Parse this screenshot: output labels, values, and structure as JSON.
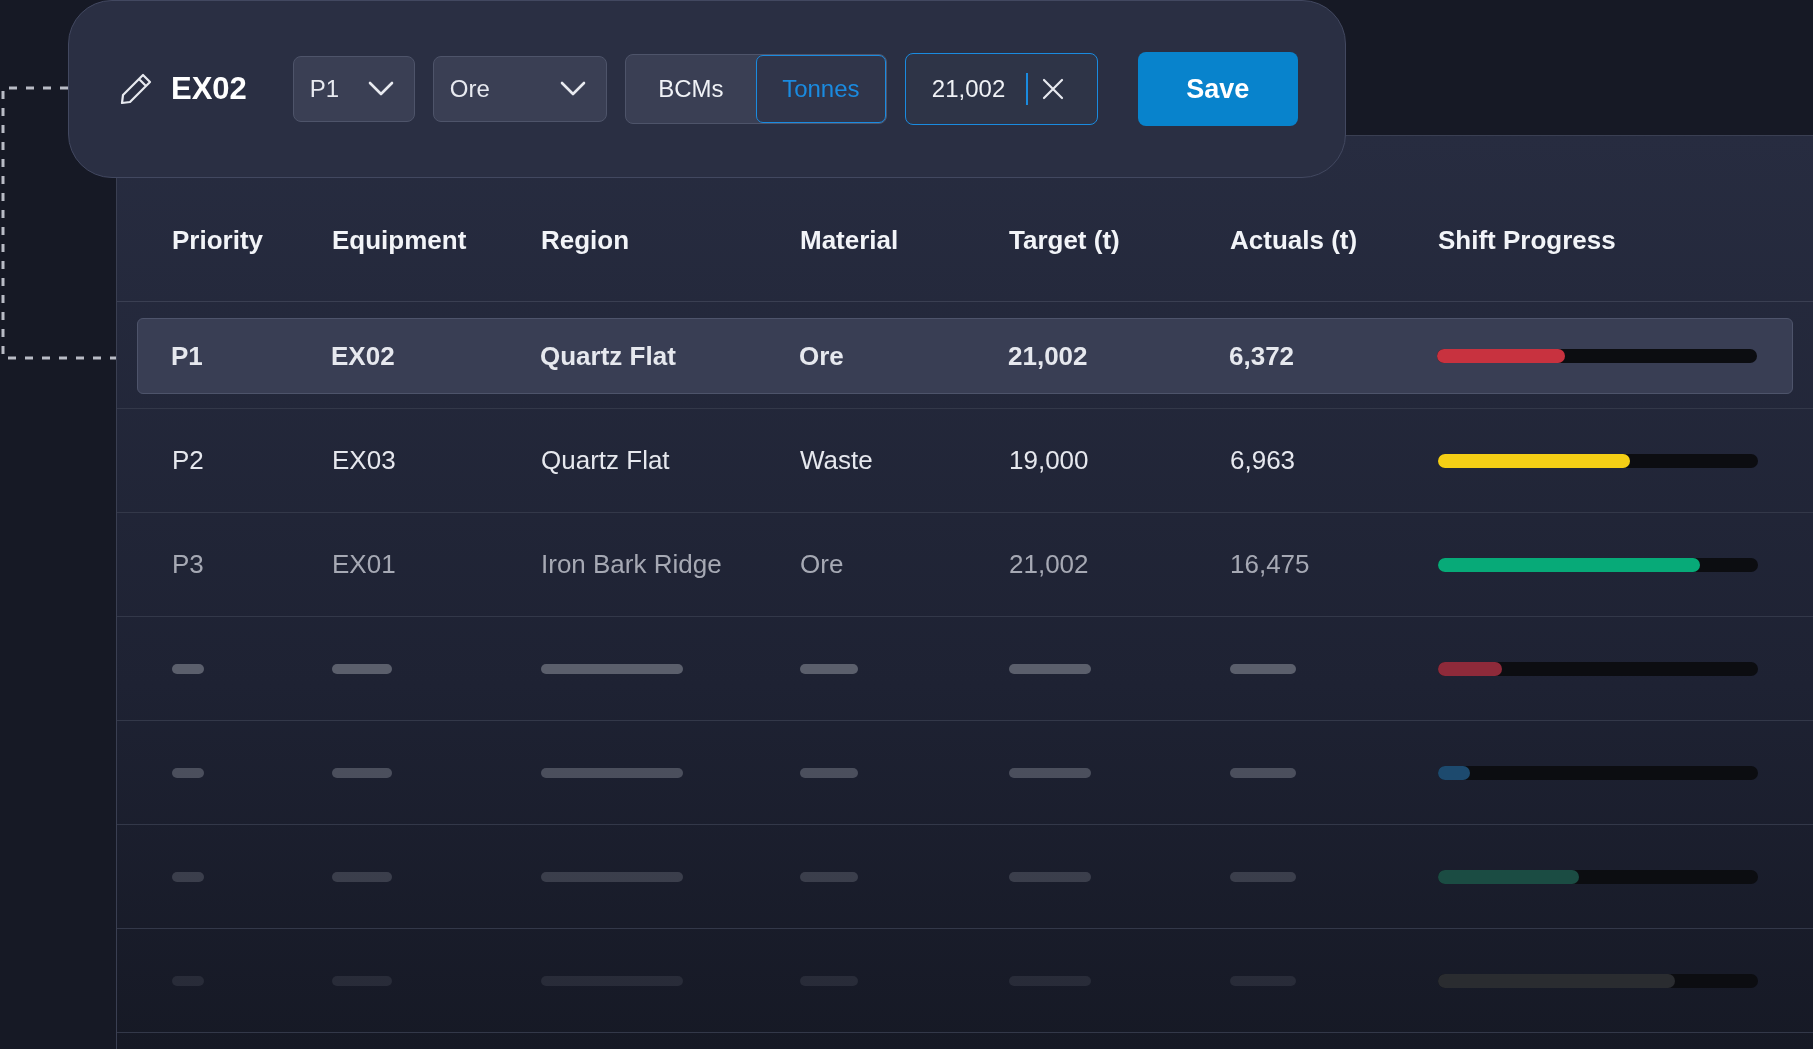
{
  "editor": {
    "title": "EX02",
    "priority": {
      "value": "P1"
    },
    "material": {
      "value": "Ore"
    },
    "units": [
      {
        "label": "BCMs",
        "selected": false
      },
      {
        "label": "Tonnes",
        "selected": true
      }
    ],
    "target": {
      "value": "21,002"
    },
    "save": "Save"
  },
  "table": {
    "columns": [
      "Priority",
      "Equipment",
      "Region",
      "Material",
      "Target (t)",
      "Actuals (t)",
      "Shift Progress"
    ],
    "rows": [
      {
        "cells": [
          "P1",
          "EX02",
          "Quartz Flat",
          "Ore",
          "21,002",
          "6,372"
        ],
        "selected": true,
        "dimmed": false,
        "level": 0.4,
        "color": "#c8323f"
      },
      {
        "cells": [
          "P2",
          "EX03",
          "Quartz Flat",
          "Waste",
          "19,000",
          "6,963"
        ],
        "selected": false,
        "dimmed": false,
        "level": 0.6,
        "color": "#f5cf15"
      },
      {
        "cells": [
          "P3",
          "EX01",
          "Iron Bark Ridge",
          "Ore",
          "21,002",
          "16,475"
        ],
        "selected": false,
        "dimmed": true,
        "level": 0.82,
        "color": "#07aa78"
      }
    ],
    "placeholder_rows": [
      {
        "level": 0.2,
        "color": "#8e2a3a"
      },
      {
        "level": 0.1,
        "color": "#1d4a6e"
      },
      {
        "level": 0.44,
        "color": "#1b4c43"
      },
      {
        "level": 0.74,
        "color": "#2a2c30"
      }
    ]
  }
}
